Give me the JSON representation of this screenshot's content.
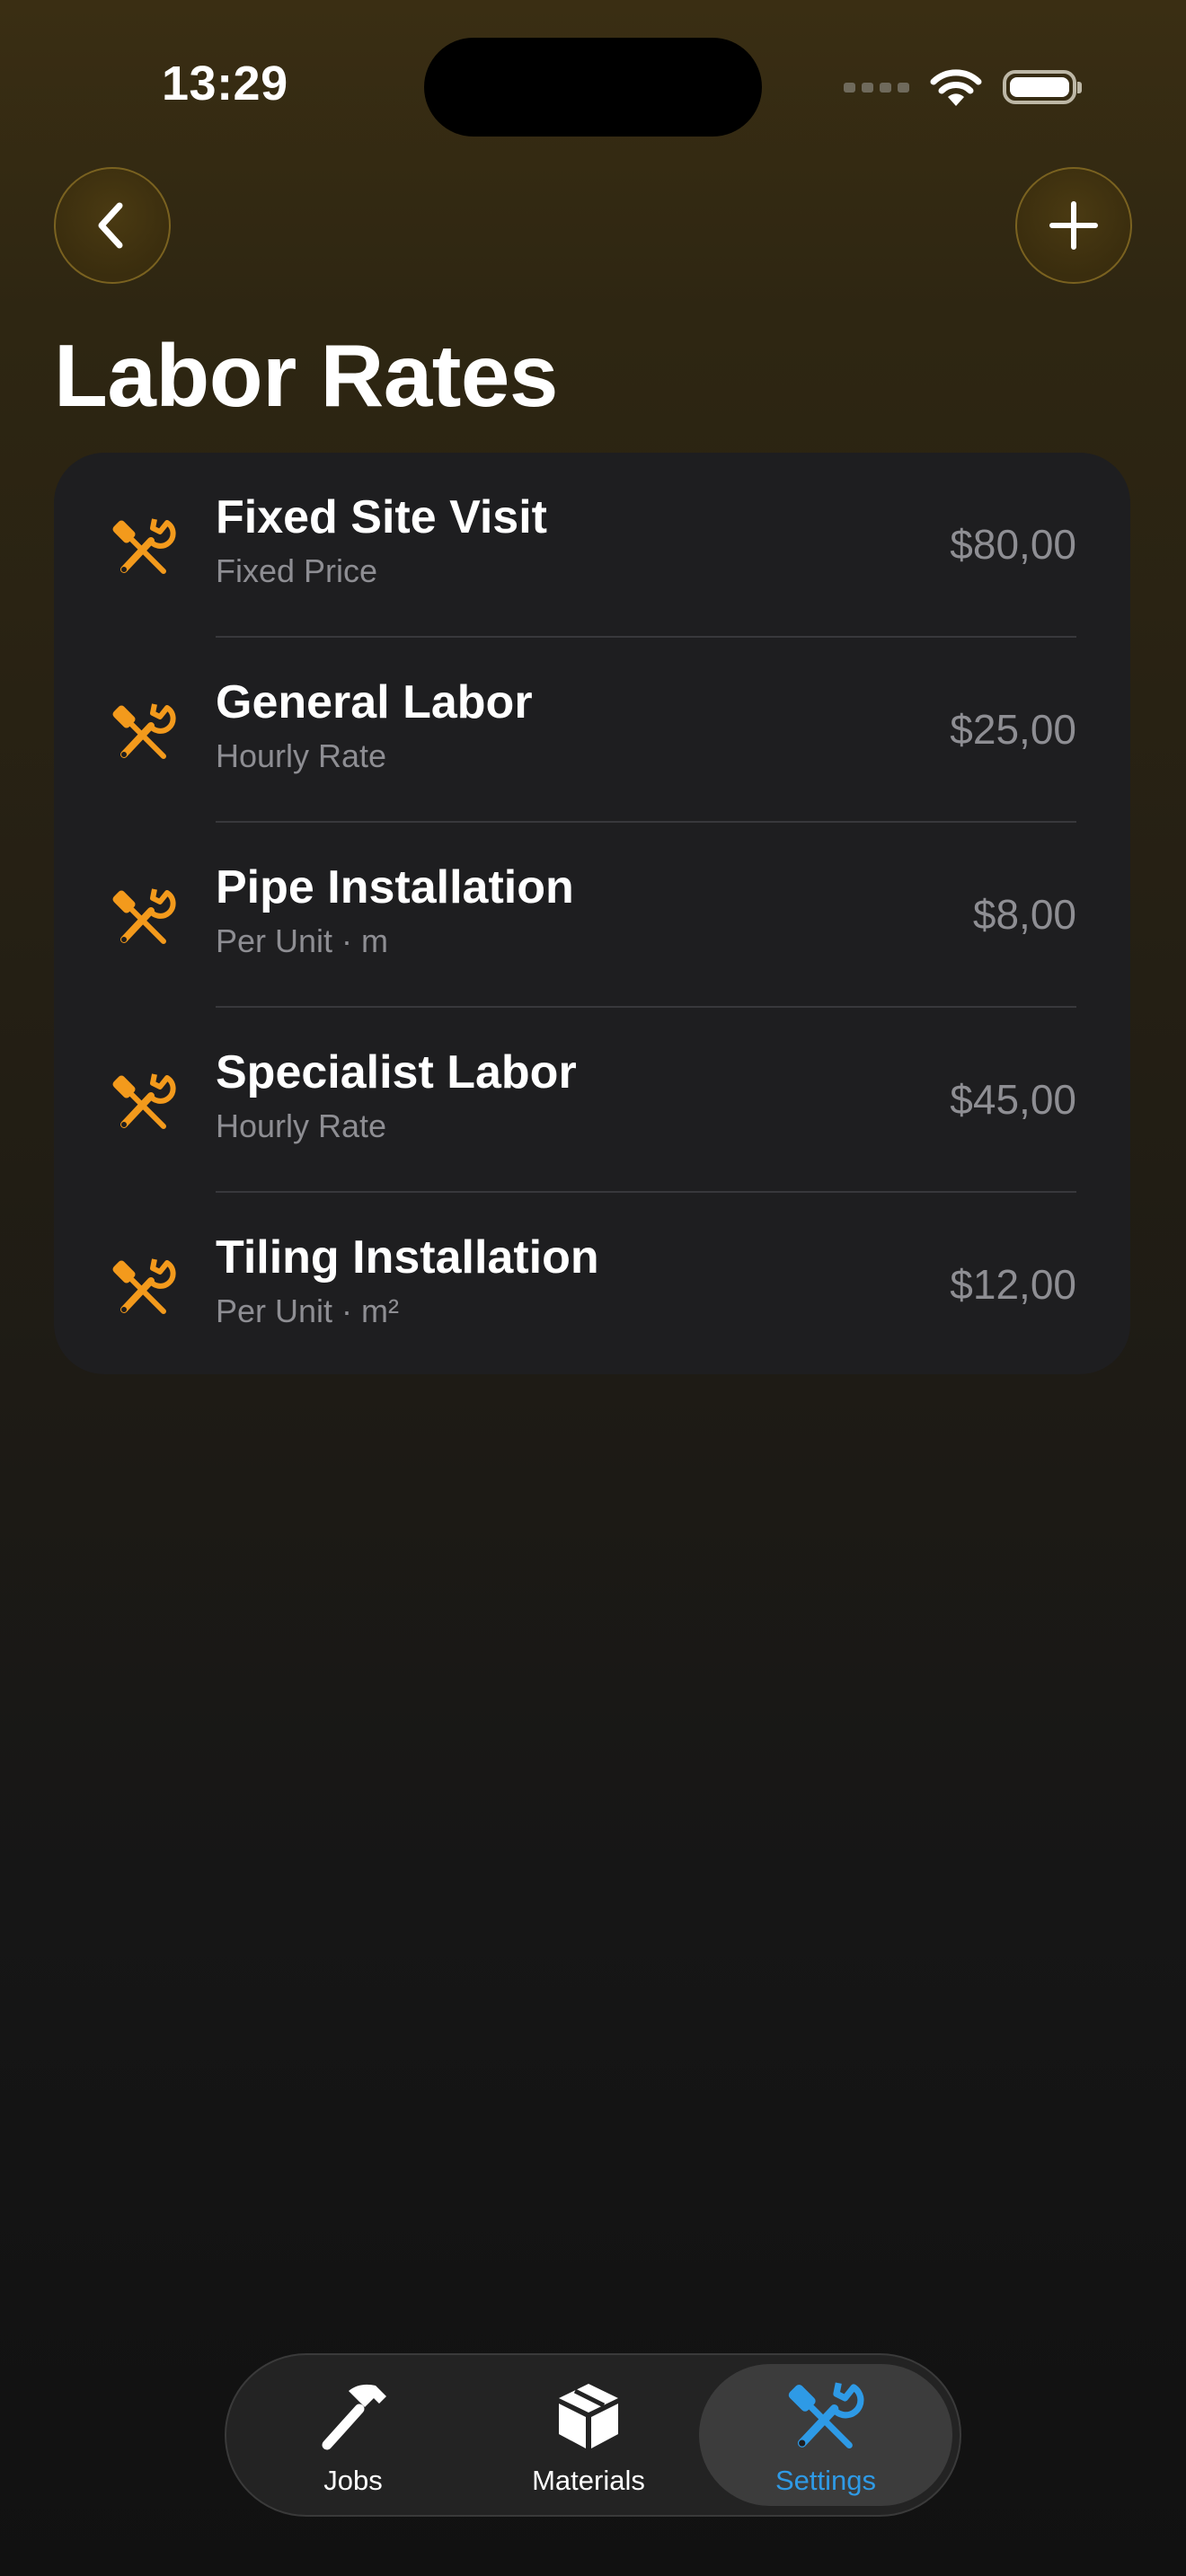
{
  "status_bar": {
    "time": "13:29"
  },
  "nav": {
    "back_icon": "chevron-left-icon",
    "add_icon": "plus-icon"
  },
  "page": {
    "title": "Labor Rates"
  },
  "labor_rates": [
    {
      "name": "Fixed Site Visit",
      "type": "Fixed Price",
      "price": "$80,00",
      "icon": "tools-icon"
    },
    {
      "name": "General Labor",
      "type": "Hourly Rate",
      "price": "$25,00",
      "icon": "tools-icon"
    },
    {
      "name": "Pipe Installation",
      "type": "Per Unit · m",
      "price": "$8,00",
      "icon": "tools-icon"
    },
    {
      "name": "Specialist Labor",
      "type": "Hourly Rate",
      "price": "$45,00",
      "icon": "tools-icon"
    },
    {
      "name": "Tiling Installation",
      "type": "Per Unit · m²",
      "price": "$12,00",
      "icon": "tools-icon"
    }
  ],
  "tab_bar": {
    "tabs": [
      {
        "label": "Jobs",
        "icon": "hammer-icon",
        "selected": false
      },
      {
        "label": "Materials",
        "icon": "box-icon",
        "selected": false
      },
      {
        "label": "Settings",
        "icon": "tools-icon",
        "selected": true
      }
    ]
  },
  "colors": {
    "accent_orange": "#f39a1c",
    "accent_blue": "#2e9ae6",
    "card_background": "#1e1e20",
    "secondary_text": "#8e8e93"
  }
}
